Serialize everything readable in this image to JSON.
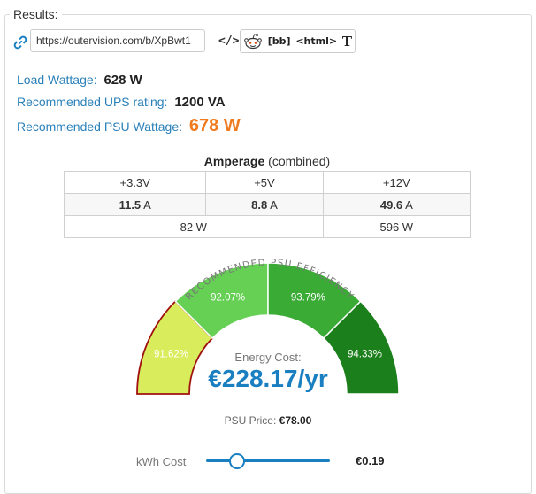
{
  "results_label": "Results:",
  "share": {
    "url": "https://outervision.com/b/XpBwt1",
    "code_icon_label": "</>",
    "buttons": {
      "bb": "[bb]",
      "html": "<html>",
      "t": "T"
    }
  },
  "stats": {
    "load_label": "Load Wattage:",
    "load_value": "628 W",
    "ups_label": "Recommended UPS rating:",
    "ups_value": "1200 VA",
    "psu_label": "Recommended PSU Wattage:",
    "psu_value": "678 W"
  },
  "amperage": {
    "title": "Amperage",
    "subtitle": "(combined)",
    "headers": [
      "+3.3V",
      "+5V",
      "+12V"
    ],
    "amps": [
      {
        "num": "11.5",
        "unit": "A"
      },
      {
        "num": "8.8",
        "unit": "A"
      },
      {
        "num": "49.6",
        "unit": "A"
      }
    ],
    "watts_combined": "82 W",
    "watts_12v": "596 W"
  },
  "gauge": {
    "arc_label": "RECOMMENDED PSU EFFICIENCY",
    "segments": [
      {
        "label": "91.62%",
        "color": "#d9ec5b",
        "selected": true
      },
      {
        "label": "92.07%",
        "color": "#66d055"
      },
      {
        "label": "93.79%",
        "color": "#3aab35"
      },
      {
        "label": "94.33%",
        "color": "#1b7f1b"
      }
    ],
    "border_color": "#a01010"
  },
  "energy": {
    "label": "Energy Cost:",
    "value": "€228.17/yr"
  },
  "psu_price": {
    "label": "PSU Price:",
    "value": "€78.00"
  },
  "kwh": {
    "label": "kWh Cost",
    "value": "€0.19",
    "slider_fraction": 0.24
  },
  "colors": {
    "accent": "#1a7fc1",
    "link": "#2a80b9",
    "highlight": "#f07b1f"
  }
}
